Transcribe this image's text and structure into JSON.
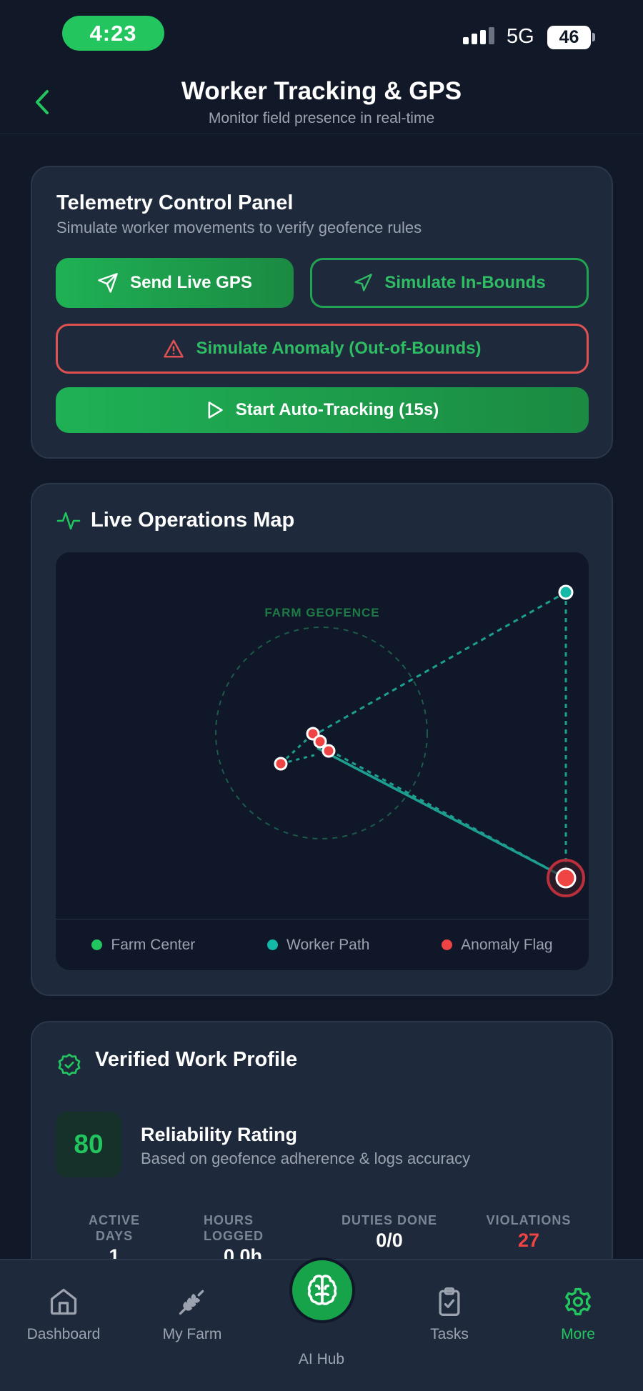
{
  "status_bar": {
    "time": "4:23",
    "network": "5G",
    "battery": "46"
  },
  "header": {
    "title": "Worker Tracking & GPS",
    "subtitle": "Monitor field presence in real-time"
  },
  "telemetry": {
    "title": "Telemetry Control Panel",
    "subtitle": "Simulate worker movements to verify geofence rules",
    "send_live_gps": "Send Live GPS",
    "simulate_in_bounds": "Simulate In-Bounds",
    "simulate_anomaly": "Simulate Anomaly (Out-of-Bounds)",
    "start_auto_tracking": "Start Auto-Tracking (15s)"
  },
  "map": {
    "title": "Live Operations Map",
    "geofence_label": "FARM GEOFENCE",
    "legend": [
      {
        "label": "Farm Center",
        "color": "#22c55e"
      },
      {
        "label": "Worker Path",
        "color": "#14b8a6"
      },
      {
        "label": "Anomaly Flag",
        "color": "#ef4444"
      }
    ]
  },
  "profile": {
    "title": "Verified Work Profile",
    "score": "80",
    "rating_title": "Reliability Rating",
    "rating_subtitle": "Based on geofence adherence & logs accuracy",
    "stats": [
      {
        "label": "ACTIVE DAYS",
        "value": "1"
      },
      {
        "label": "HOURS LOGGED",
        "value": "0.0h"
      },
      {
        "label": "DUTIES DONE",
        "value": "0/0"
      },
      {
        "label": "VIOLATIONS",
        "value": "27"
      }
    ]
  },
  "nav": {
    "dashboard": "Dashboard",
    "my_farm": "My Farm",
    "ai_hub": "AI Hub",
    "tasks": "Tasks",
    "more": "More"
  },
  "colors": {
    "accent_green": "#22c55e",
    "teal": "#14b8a6",
    "danger_red": "#ef4444",
    "background": "#111827",
    "card": "#1e293b"
  }
}
